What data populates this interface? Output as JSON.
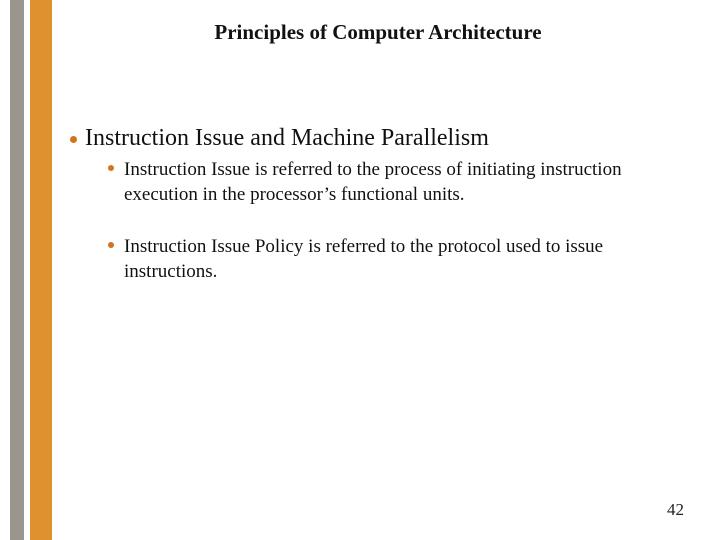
{
  "title": "Principles of Computer Architecture",
  "main": {
    "text": "Instruction Issue and Machine Parallelism"
  },
  "subs": [
    {
      "text": "Instruction Issue is referred to the process of initiating instruction execution in the processor’s functional units."
    },
    {
      "text": "Instruction Issue Policy is referred to the protocol used to issue instructions."
    }
  ],
  "page_number": "42"
}
